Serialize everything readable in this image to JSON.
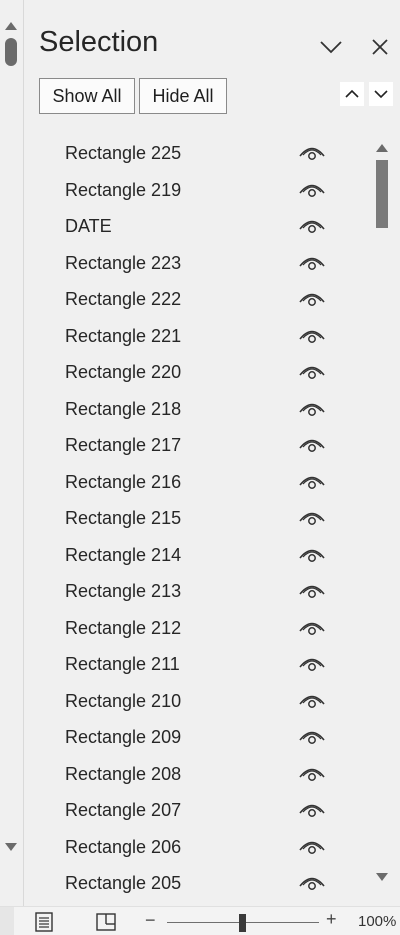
{
  "pane": {
    "title": "Selection",
    "show_all_label": "Show All",
    "hide_all_label": "Hide All"
  },
  "items": [
    {
      "label": "Rectangle 225",
      "visible": true
    },
    {
      "label": "Rectangle 219",
      "visible": true
    },
    {
      "label": "DATE",
      "visible": true
    },
    {
      "label": "Rectangle 223",
      "visible": true
    },
    {
      "label": "Rectangle 222",
      "visible": true
    },
    {
      "label": "Rectangle 221",
      "visible": true
    },
    {
      "label": "Rectangle 220",
      "visible": true
    },
    {
      "label": "Rectangle 218",
      "visible": true
    },
    {
      "label": "Rectangle 217",
      "visible": true
    },
    {
      "label": "Rectangle 216",
      "visible": true
    },
    {
      "label": "Rectangle 215",
      "visible": true
    },
    {
      "label": "Rectangle 214",
      "visible": true
    },
    {
      "label": "Rectangle 213",
      "visible": true
    },
    {
      "label": "Rectangle 212",
      "visible": true
    },
    {
      "label": "Rectangle 211",
      "visible": true
    },
    {
      "label": "Rectangle 210",
      "visible": true
    },
    {
      "label": "Rectangle 209",
      "visible": true
    },
    {
      "label": "Rectangle 208",
      "visible": true
    },
    {
      "label": "Rectangle 207",
      "visible": true
    },
    {
      "label": "Rectangle 206",
      "visible": true
    },
    {
      "label": "Rectangle 205",
      "visible": true
    }
  ],
  "status_bar": {
    "zoom_level": "100%",
    "zoom_minus": "−",
    "zoom_plus": "+"
  },
  "icons": {
    "header_chevron": "chevron-down-icon",
    "header_close": "close-icon",
    "item_visibility": "eye-icon",
    "order_up": "chevron-up-icon",
    "order_down": "chevron-down-icon"
  }
}
